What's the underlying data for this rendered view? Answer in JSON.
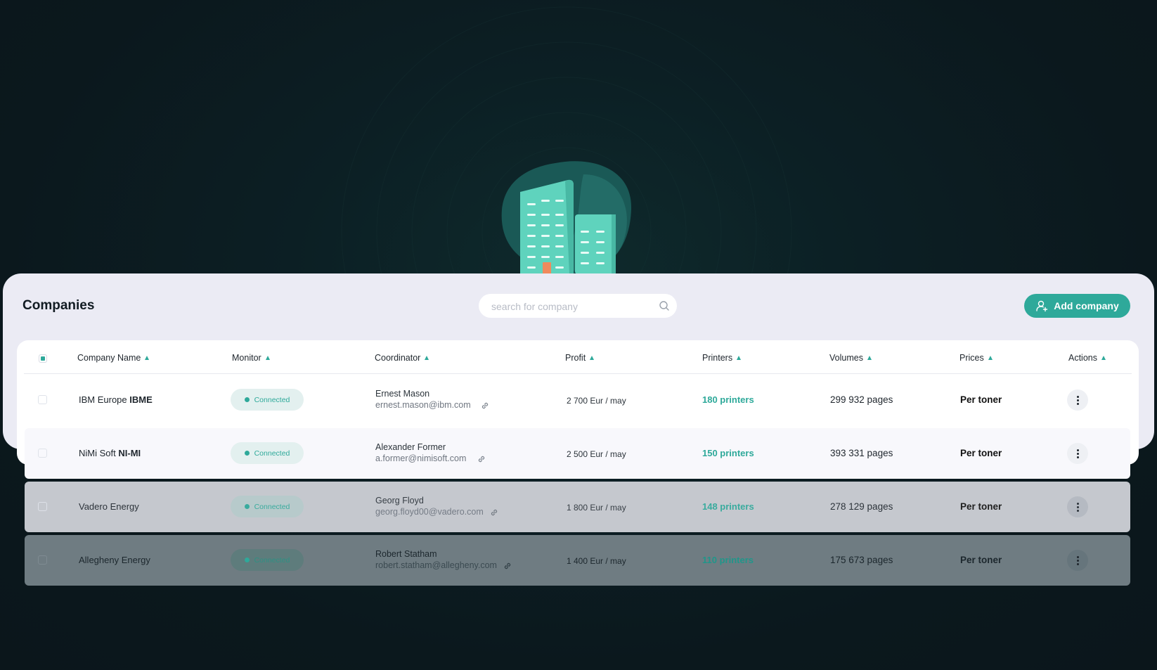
{
  "header": {
    "title": "Companies",
    "search_placeholder": "search for company",
    "add_button_label": "Add company"
  },
  "table": {
    "columns": [
      "Company Name",
      "Monitor",
      "Coordinator",
      "Profit",
      "Printers",
      "Volumes",
      "Prices",
      "Actions"
    ],
    "rows": [
      {
        "company": "IBM Europe",
        "company_code": "IBME",
        "monitor": "Connected",
        "coordinator_name": "Ernest Mason",
        "coordinator_email": "ernest.mason@ibm.com",
        "profit": "2 700 Eur / may",
        "printers": "180 printers",
        "volumes": "299 932 pages",
        "prices": "Per toner"
      },
      {
        "company": "NiMi Soft",
        "company_code": "NI-MI",
        "monitor": "Connected",
        "coordinator_name": "Alexander Former",
        "coordinator_email": "a.former@nimisoft.com",
        "profit": "2 500 Eur / may",
        "printers": "150 printers",
        "volumes": "393 331 pages",
        "prices": "Per toner"
      },
      {
        "company": "Vadero Energy",
        "company_code": "",
        "monitor": "Connected",
        "coordinator_name": "Georg Floyd",
        "coordinator_email": "georg.floyd00@vadero.com",
        "profit": "1 800 Eur / may",
        "printers": "148 printers",
        "volumes": "278 129 pages",
        "prices": "Per toner"
      },
      {
        "company": "Allegheny Energy",
        "company_code": "",
        "monitor": "Connected",
        "coordinator_name": "Robert Statham",
        "coordinator_email": "robert.statham@allegheny.com",
        "profit": "1 400 Eur / may",
        "printers": "110 printers",
        "volumes": "175 673 pages",
        "prices": "Per toner"
      }
    ]
  },
  "colors": {
    "accent": "#2ea99a",
    "background": "#0b181d",
    "card": "#ebebf4"
  },
  "icons": [
    "building-illustration",
    "search-icon",
    "add-user-icon",
    "sort-icon",
    "link-icon",
    "more-vertical-icon"
  ]
}
